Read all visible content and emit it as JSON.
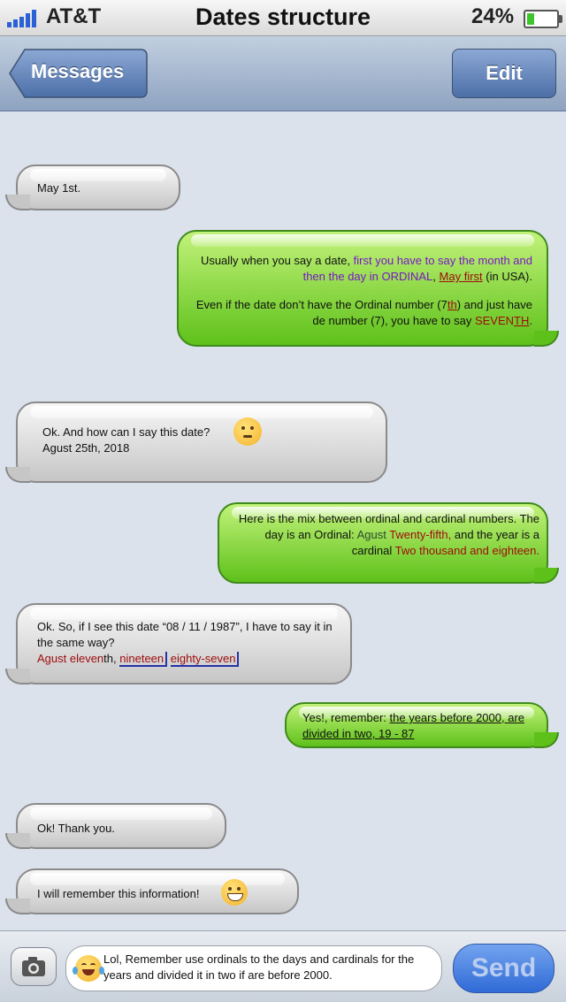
{
  "status_bar": {
    "carrier": "AT&T",
    "title": "Dates structure",
    "battery": "24%",
    "battery_level": 0.24,
    "signal_icon": "signal-bars-icon",
    "battery_icon": "battery-icon"
  },
  "nav": {
    "back_label": "Messages",
    "edit_label": "Edit"
  },
  "messages": {
    "m1": {
      "text": "May 1st."
    },
    "m2": {
      "p1_a": "Usually when you say a date, ",
      "p1_purple": "first you have to say the month and then the day in ORDINAL",
      "p1_b": ", ",
      "p1_underlined": "May first",
      "p1_c": " (in USA).",
      "p2_a": "Even if the date don’t have the Ordinal number (7",
      "p2_th": "th",
      "p2_b": ") and just have de number (7), you have to say ",
      "p2_seven": "SEVEN",
      "p2_th2": "TH",
      "p2_c": "."
    },
    "m3": {
      "line1": "Ok. And how can I say this date?",
      "line2": "Agust 25th, 2018",
      "emoji": "thinking-face-emoji"
    },
    "m4": {
      "a": "Here is the mix between ordinal and cardinal numbers. The day is an Ordinal: ",
      "agust": "Agust ",
      "twentyfifth": "Twenty-fifth,",
      "b": " and the year is a cardinal ",
      "year": "Two thousand and eighteen."
    },
    "m5": {
      "line1": "Ok. So, if I see this date  “08 / 11 / 1987”, I have to say it in the same way?",
      "agust": "Agust eleven",
      "th": "th",
      "comma": ", ",
      "nineteen": "nineteen",
      "eightyseven": "eighty-seven"
    },
    "m6": {
      "a": "Yes!, remember: ",
      "b": "the years before 2000, are divided in two, 19 - 87 "
    },
    "m7": {
      "text": "Ok! Thank you."
    },
    "m8": {
      "text": "I will remember this information!",
      "emoji": "grinning-face-emoji"
    }
  },
  "input": {
    "text": "Lol, Remember use ordinals to the days and cardinals for the years and divided it in two if are before 2000.",
    "emoji": "tears-of-joy-emoji",
    "send_label": "Send",
    "camera_icon": "camera-icon"
  },
  "colors": {
    "purple": "#7a16c8",
    "red": "#9e0b0b",
    "green": "#5ec11a",
    "blue_underline": "#2332a8"
  }
}
